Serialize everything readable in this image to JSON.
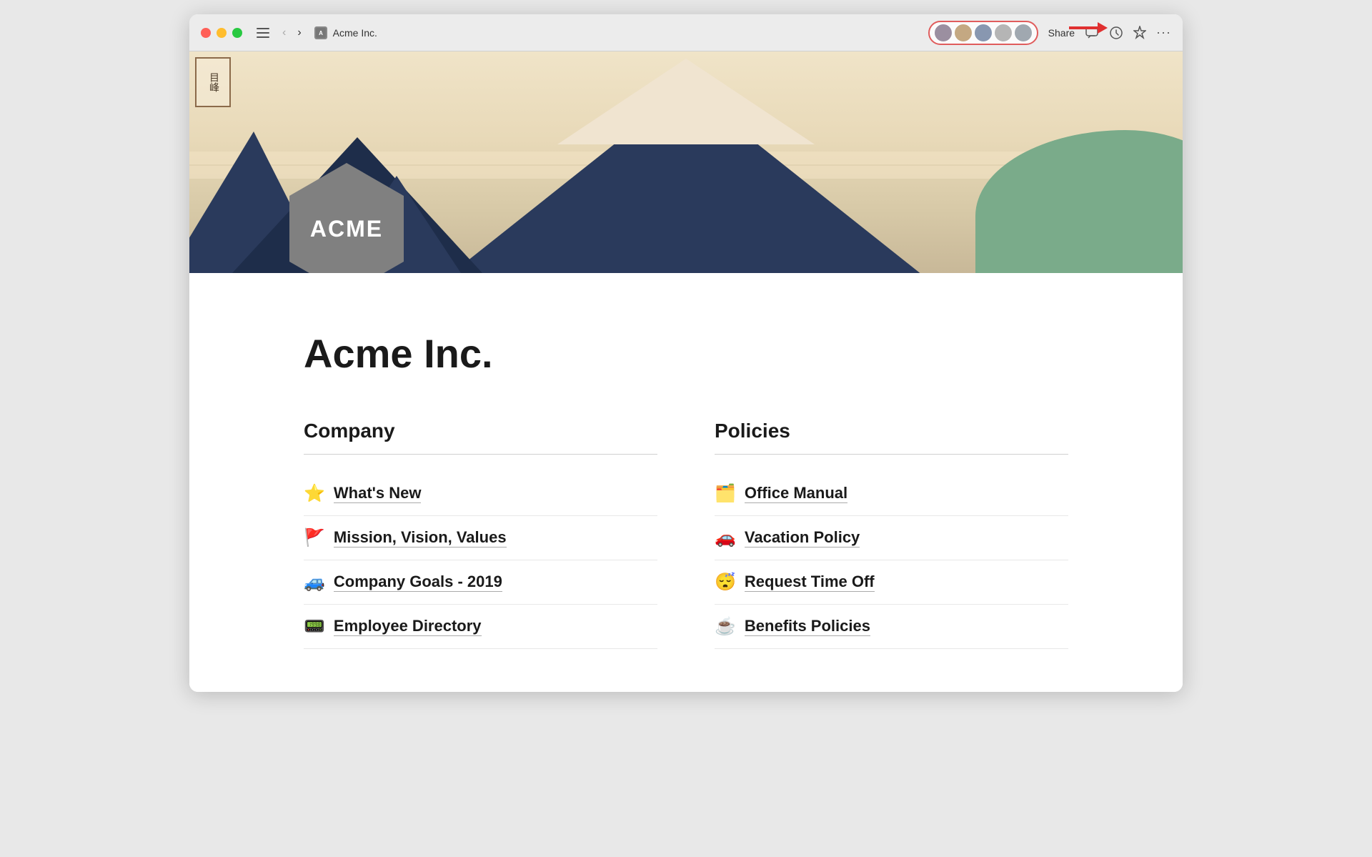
{
  "browser": {
    "title": "Acme Inc.",
    "favicon_label": "A",
    "back_btn": "‹",
    "forward_btn": "›",
    "share_label": "Share",
    "more_label": "···"
  },
  "toolbar": {
    "comment_icon": "💬",
    "history_icon": "🕐",
    "star_icon": "☆"
  },
  "hero": {
    "jp_chars": "目峰",
    "acme_label": "ACME"
  },
  "page": {
    "title": "Acme Inc."
  },
  "company": {
    "heading": "Company",
    "items": [
      {
        "emoji": "⭐",
        "label": "What's New"
      },
      {
        "emoji": "🚩",
        "label": "Mission, Vision, Values"
      },
      {
        "emoji": "🚙",
        "label": "Company Goals - 2019"
      },
      {
        "emoji": "📟",
        "label": "Employee Directory"
      }
    ]
  },
  "policies": {
    "heading": "Policies",
    "items": [
      {
        "emoji": "🗂️",
        "label": "Office Manual"
      },
      {
        "emoji": "🚗",
        "label": "Vacation Policy"
      },
      {
        "emoji": "😴",
        "label": "Request Time Off"
      },
      {
        "emoji": "☕",
        "label": "Benefits Policies"
      }
    ]
  }
}
